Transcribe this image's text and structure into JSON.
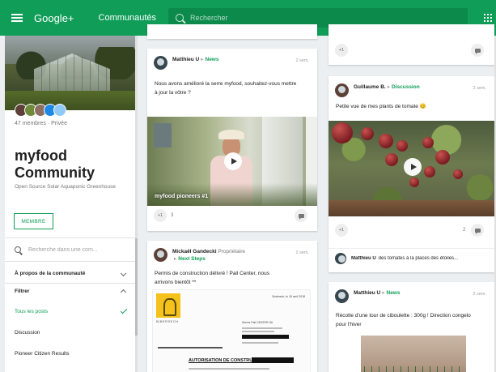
{
  "topbar": {
    "brand": "Google+",
    "section": "Communautés",
    "search_placeholder": "Rechercher"
  },
  "community": {
    "members": "47 membres · Privée",
    "title": "myfood Community",
    "subtitle": "Open Source Solar Aquaponic Greenhouse",
    "member_button": "MEMBRE",
    "search_placeholder": "Recherche dans une com...",
    "menu": {
      "about": "À propos de la communauté",
      "filter": "Filtrer",
      "all_posts": "Tous les posts",
      "discussion": "Discussion",
      "pioneer": "Pioneer Citizen Results"
    },
    "avatar_colors": [
      "#5d4037",
      "#6d8b3a",
      "#8d6e63",
      "#1e88e5",
      "#90caf9"
    ]
  },
  "posts": {
    "top_left": {
      "plus": "+1"
    },
    "top_right": {
      "plus": "+1"
    },
    "p1": {
      "author": "Matthieu U",
      "category": "News",
      "time": "2 sem.",
      "text": "Nous avons amélioré la serre myfood, souhaitez-vous mettre à jour la vôtre ?",
      "video_caption": "myfood pioneers #1",
      "plus": "+1",
      "count": "3"
    },
    "p2": {
      "author": "Mickaël Gandecki",
      "role": "Propriétaire",
      "category": "Next Steps",
      "time": "2 sem.",
      "text": "Permis de construction délivré ! Pail Center, nous arrivons bientôt **",
      "doc_logo_text": "BIBERSECH",
      "doc_date": "Bodersch, le 18 avril 2018",
      "doc_recipient": "Serres Pail CENTER SA",
      "doc_heading": "AUTORISATION DE CONSTRUIRE"
    },
    "p3": {
      "author": "Guillaume B.",
      "category": "Discussion",
      "time": "2 sem.",
      "text": "Petite vue de mes plants de tomate 😊",
      "plus": "+1",
      "comment_count": "2",
      "comment_author": "Matthieu U",
      "comment_text": "des tomates à la places des étoiles..."
    },
    "p4": {
      "author": "Matthieu U",
      "category": "News",
      "time": "2 sem.",
      "text": "Récolte d'une tour de ciboulette : 300g ! Direction congelo pour l'hiver"
    }
  },
  "colors": {
    "brand_green": "#0f9d58",
    "background": "#eceff1"
  }
}
